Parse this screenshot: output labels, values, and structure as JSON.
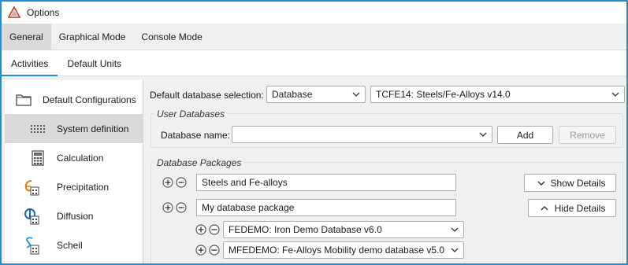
{
  "window": {
    "title": "Options"
  },
  "main_tabs": [
    {
      "label": "General",
      "active": true
    },
    {
      "label": "Graphical Mode",
      "active": false
    },
    {
      "label": "Console Mode",
      "active": false
    }
  ],
  "sub_tabs": [
    {
      "label": "Activities",
      "active": true
    },
    {
      "label": "Default Units",
      "active": false
    }
  ],
  "sidebar": {
    "items": [
      {
        "label": "Default Configurations",
        "icon": "folder-icon"
      },
      {
        "label": "System definition",
        "icon": "grid-icon",
        "selected": true
      },
      {
        "label": "Calculation",
        "icon": "calculator-icon"
      },
      {
        "label": "Precipitation",
        "icon": "precipitation-icon"
      },
      {
        "label": "Diffusion",
        "icon": "diffusion-icon"
      },
      {
        "label": "Scheil",
        "icon": "scheil-icon"
      }
    ]
  },
  "db_selection": {
    "label": "Default database selection:",
    "type_value": "Database",
    "database_value": "TCFE14: Steels/Fe-Alloys v14.0"
  },
  "user_databases": {
    "title": "User Databases",
    "name_label": "Database name:",
    "name_value": "",
    "add_label": "Add",
    "remove_label": "Remove"
  },
  "database_packages": {
    "title": "Database Packages",
    "packages": [
      {
        "name": "Steels and Fe-alloys",
        "details_label": "Show Details"
      },
      {
        "name": "My database package",
        "details_label": "Hide Details"
      }
    ],
    "sub_items": [
      "FEDEMO: Iron Demo Database v6.0",
      "MFEDEMO: Fe-Alloys Mobility demo database v5.0"
    ]
  },
  "colors": {
    "accent": "#1e8fd6",
    "selected_bg": "#d9d9d9"
  }
}
